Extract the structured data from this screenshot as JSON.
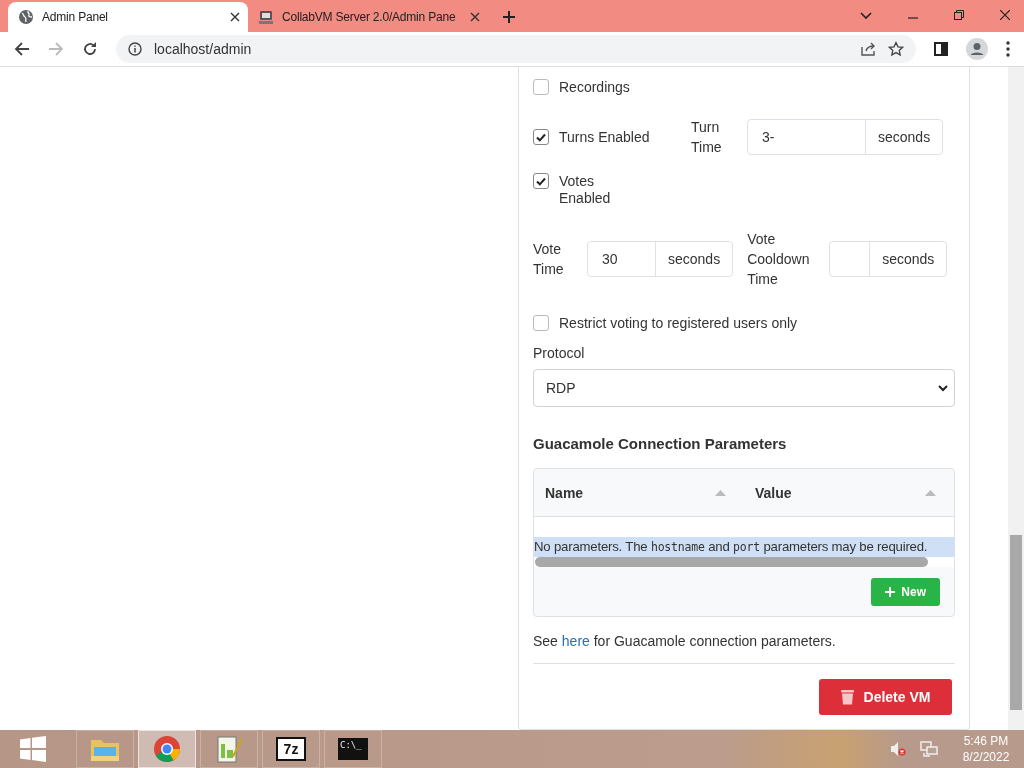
{
  "browser": {
    "tabs": [
      {
        "title": "Admin Panel",
        "selected": true,
        "kind": "globe"
      },
      {
        "title": "CollabVM Server 2.0/Admin Pane",
        "selected": false,
        "kind": "computer"
      }
    ],
    "address": "localhost/admin",
    "forward_disabled": true
  },
  "recordings": {
    "label": "Recordings",
    "checked": false
  },
  "turns": {
    "label": "Turns Enabled",
    "checked": true,
    "time_label": "Turn Time",
    "time_value": "3-",
    "unit": "seconds"
  },
  "votes": {
    "label": "Votes Enabled",
    "checked": true
  },
  "vote_time": {
    "label": "Vote Time",
    "value": "30",
    "unit": "seconds"
  },
  "vote_cooldown": {
    "label": "Vote Cooldown Time",
    "unit": "seconds"
  },
  "restrict_voting": {
    "label": "Restrict voting to registered users only",
    "checked": false
  },
  "protocol": {
    "label": "Protocol",
    "value": "RDP"
  },
  "guacamole": {
    "heading": "Guacamole Connection Parameters",
    "columns": [
      {
        "label": "Name"
      },
      {
        "label": "Value"
      }
    ],
    "empty_message": [
      {
        "kind": "text",
        "text": "No parameters. The "
      },
      {
        "kind": "code",
        "text": "hostname"
      },
      {
        "kind": "text",
        "text": " and "
      },
      {
        "kind": "code",
        "text": "port"
      },
      {
        "kind": "text",
        "text": " parameters may be required."
      }
    ],
    "new_button": "New"
  },
  "help": {
    "before": "See ",
    "link": "here",
    "after": " for Guacamole connection parameters."
  },
  "delete_button": "Delete VM",
  "taskbar": {
    "apps": [
      {
        "kind": "folder",
        "selected": false
      },
      {
        "kind": "browser",
        "selected": true
      },
      {
        "kind": "notepad",
        "selected": false
      },
      {
        "kind": "archiver",
        "glyph": "7z",
        "selected": false
      },
      {
        "kind": "terminal",
        "glyph": "C:\\_",
        "selected": false
      }
    ],
    "time": "5:46 PM",
    "date": "8/2/2022"
  }
}
